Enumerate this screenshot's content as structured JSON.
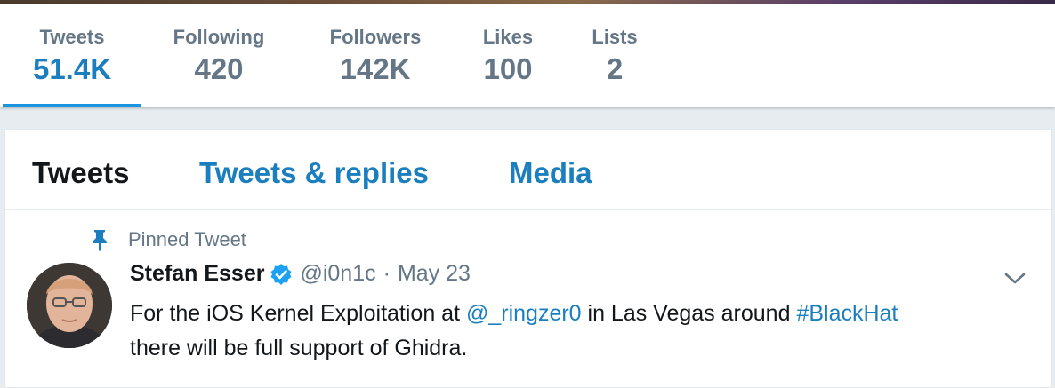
{
  "stats": [
    {
      "label": "Tweets",
      "value": "51.4K",
      "active": true
    },
    {
      "label": "Following",
      "value": "420",
      "active": false
    },
    {
      "label": "Followers",
      "value": "142K",
      "active": false
    },
    {
      "label": "Likes",
      "value": "100",
      "active": false
    },
    {
      "label": "Lists",
      "value": "2",
      "active": false
    }
  ],
  "tabs": [
    {
      "label": "Tweets",
      "active": true
    },
    {
      "label": "Tweets & replies",
      "active": false
    },
    {
      "label": "Media",
      "active": false
    }
  ],
  "pinned": {
    "label": "Pinned Tweet",
    "icon": "pin-icon"
  },
  "tweet": {
    "author_name": "Stefan Esser",
    "handle": "@i0n1c",
    "separator": "·",
    "date": "May 23",
    "verified_icon": "verified-badge-icon",
    "text_1": "For the iOS Kernel Exploitation at ",
    "mention": "@_ringzer0",
    "text_2": " in Las Vegas around ",
    "hashtag": "#BlackHat",
    "text_3": "there will be full support of Ghidra."
  },
  "colors": {
    "accent": "#1b95e0",
    "link": "#1b7fbf",
    "muted": "#657786",
    "text": "#14171a",
    "background": "#e6ecf0"
  }
}
